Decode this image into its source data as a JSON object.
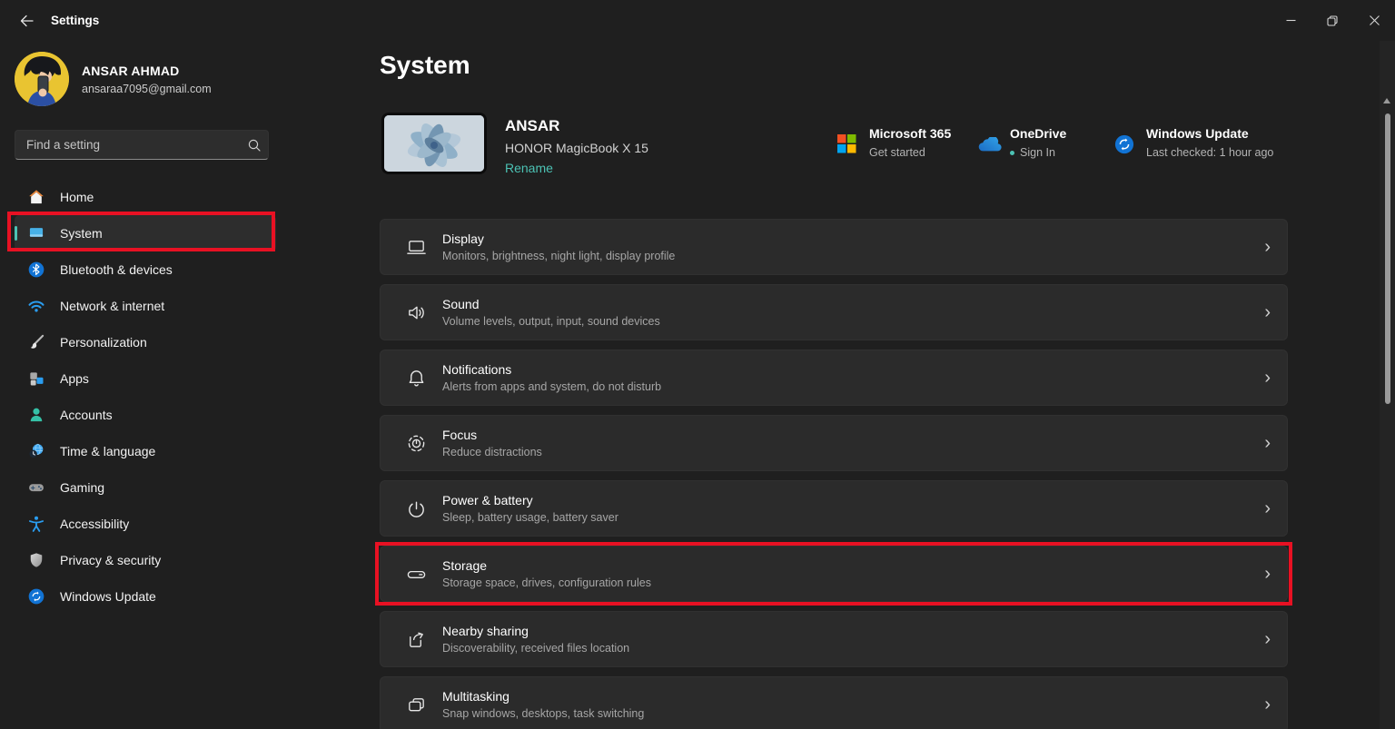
{
  "colors": {
    "accent": "#4cc2b4",
    "annotation_red": "#e81123",
    "ms365": [
      "#f25022",
      "#7fba00",
      "#00a4ef",
      "#ffb900"
    ],
    "onedrive_blue": "#1f7cd4",
    "update_blue": "#1173d4"
  },
  "titlebar": {
    "title": "Settings"
  },
  "user": {
    "name": "ANSAR AHMAD",
    "email": "ansaraa7095@gmail.com"
  },
  "search": {
    "placeholder": "Find a setting"
  },
  "sidebar": {
    "items": [
      {
        "label": "Home",
        "icon": "home-icon",
        "selected": false
      },
      {
        "label": "System",
        "icon": "system-icon",
        "selected": true
      },
      {
        "label": "Bluetooth & devices",
        "icon": "bluetooth-icon",
        "selected": false
      },
      {
        "label": "Network & internet",
        "icon": "network-icon",
        "selected": false
      },
      {
        "label": "Personalization",
        "icon": "personalization-icon",
        "selected": false
      },
      {
        "label": "Apps",
        "icon": "apps-icon",
        "selected": false
      },
      {
        "label": "Accounts",
        "icon": "accounts-icon",
        "selected": false
      },
      {
        "label": "Time & language",
        "icon": "time-language-icon",
        "selected": false
      },
      {
        "label": "Gaming",
        "icon": "gaming-icon",
        "selected": false
      },
      {
        "label": "Accessibility",
        "icon": "accessibility-icon",
        "selected": false
      },
      {
        "label": "Privacy & security",
        "icon": "privacy-icon",
        "selected": false
      },
      {
        "label": "Windows Update",
        "icon": "windows-update-icon",
        "selected": false
      }
    ]
  },
  "page": {
    "title": "System",
    "device": {
      "name": "ANSAR",
      "model": "HONOR MagicBook X 15",
      "rename": "Rename"
    },
    "quick_links": [
      {
        "title": "Microsoft 365",
        "subtitle": "Get started"
      },
      {
        "title": "OneDrive",
        "subtitle": "Sign In"
      },
      {
        "title": "Windows Update",
        "subtitle": "Last checked: 1 hour ago"
      }
    ],
    "rows": [
      {
        "title": "Display",
        "subtitle": "Monitors, brightness, night light, display profile"
      },
      {
        "title": "Sound",
        "subtitle": "Volume levels, output, input, sound devices"
      },
      {
        "title": "Notifications",
        "subtitle": "Alerts from apps and system, do not disturb"
      },
      {
        "title": "Focus",
        "subtitle": "Reduce distractions"
      },
      {
        "title": "Power & battery",
        "subtitle": "Sleep, battery usage, battery saver"
      },
      {
        "title": "Storage",
        "subtitle": "Storage space, drives, configuration rules",
        "highlighted": true
      },
      {
        "title": "Nearby sharing",
        "subtitle": "Discoverability, received files location"
      },
      {
        "title": "Multitasking",
        "subtitle": "Snap windows, desktops, task switching"
      }
    ]
  }
}
